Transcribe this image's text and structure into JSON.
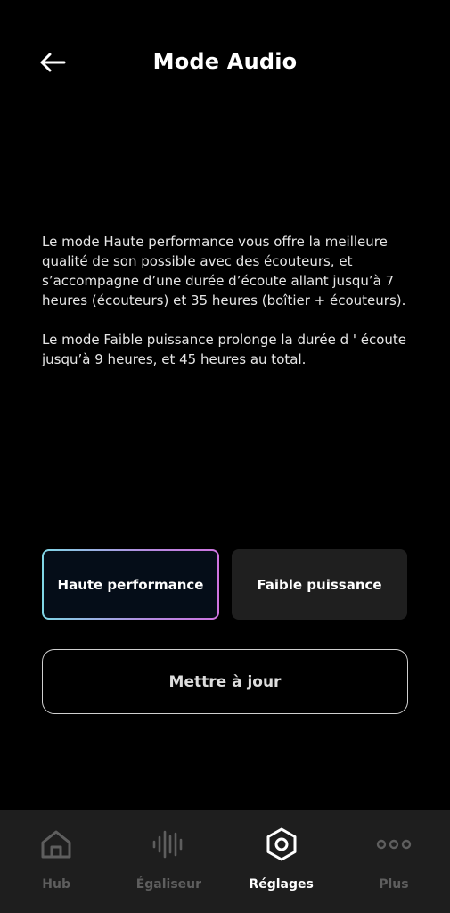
{
  "header": {
    "title": "Mode Audio",
    "back_icon": "arrow-left-icon"
  },
  "description": {
    "paragraph1": "Le mode Haute performance vous offre la meilleure qualité de son possible avec des écouteurs, et s’accompagne d’une durée d’écoute allant jusqu’à 7 heures (écouteurs) et 35 heures (boîtier + écouteurs).",
    "paragraph2": "Le mode Faible puissance prolonge la durée d ' écoute jusqu’à 9 heures, et 45 heures au total."
  },
  "modes": {
    "selected": "Haute performance",
    "options": [
      {
        "label": "Haute performance",
        "selected": true
      },
      {
        "label": "Faible puissance",
        "selected": false
      }
    ]
  },
  "update_button": {
    "label": "Mettre à jour"
  },
  "nav": {
    "items": [
      {
        "label": "Hub",
        "icon": "home-icon",
        "active": false
      },
      {
        "label": "Égaliseur",
        "icon": "equalizer-icon",
        "active": false
      },
      {
        "label": "Réglages",
        "icon": "settings-hexagon-icon",
        "active": true
      },
      {
        "label": "Plus",
        "icon": "more-dots-icon",
        "active": false
      }
    ]
  },
  "colors": {
    "background": "#000000",
    "nav_background": "#1e1e1e",
    "inactive_nav": "#5e5e5e",
    "selected_gradient_start": "#7fd6e6",
    "selected_gradient_end": "#cf74e0",
    "unselected_button": "#1f1f1f"
  }
}
